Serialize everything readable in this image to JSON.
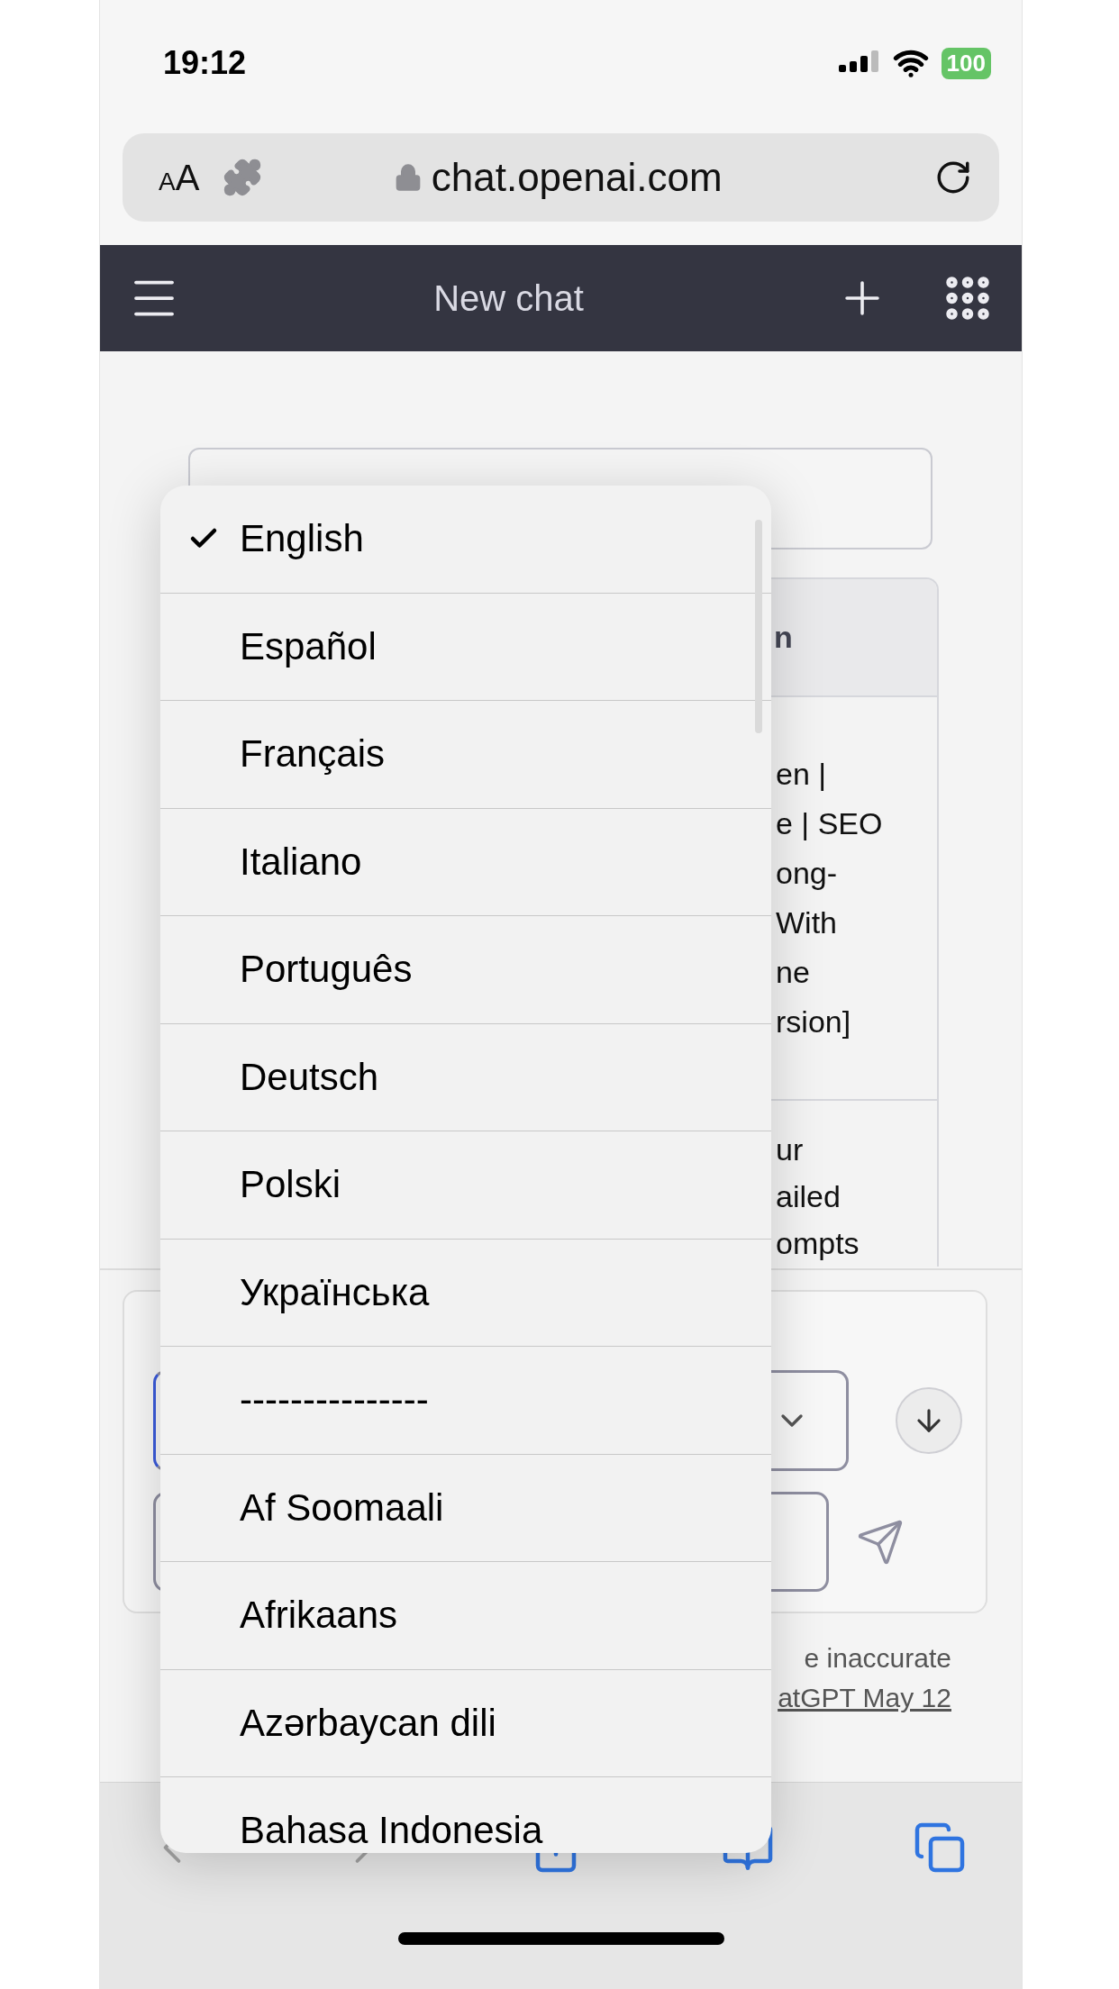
{
  "status_bar": {
    "time": "19:12",
    "battery": "100"
  },
  "browser": {
    "text_size": "AA",
    "url": "chat.openai.com"
  },
  "nav": {
    "title": "New chat"
  },
  "table": {
    "header": "n",
    "rows": [
      [
        "en |",
        "e | SEO",
        "ong-",
        "With",
        "ne",
        "rsion]"
      ],
      [
        "ur",
        "ailed",
        "ompts"
      ]
    ]
  },
  "footer": [
    "e inaccurate",
    "atGPT May 12"
  ],
  "language_menu": [
    {
      "label": "English",
      "selected": true
    },
    {
      "label": "Español",
      "selected": false
    },
    {
      "label": "Français",
      "selected": false
    },
    {
      "label": "Italiano",
      "selected": false
    },
    {
      "label": "Português",
      "selected": false
    },
    {
      "label": "Deutsch",
      "selected": false
    },
    {
      "label": "Polski",
      "selected": false
    },
    {
      "label": "Українська",
      "selected": false
    },
    {
      "label": "---------------",
      "selected": false
    },
    {
      "label": "Af Soomaali",
      "selected": false
    },
    {
      "label": "Afrikaans",
      "selected": false
    },
    {
      "label": "Azərbaycan dili",
      "selected": false
    },
    {
      "label": "Bahasa Indonesia",
      "selected": false
    }
  ]
}
